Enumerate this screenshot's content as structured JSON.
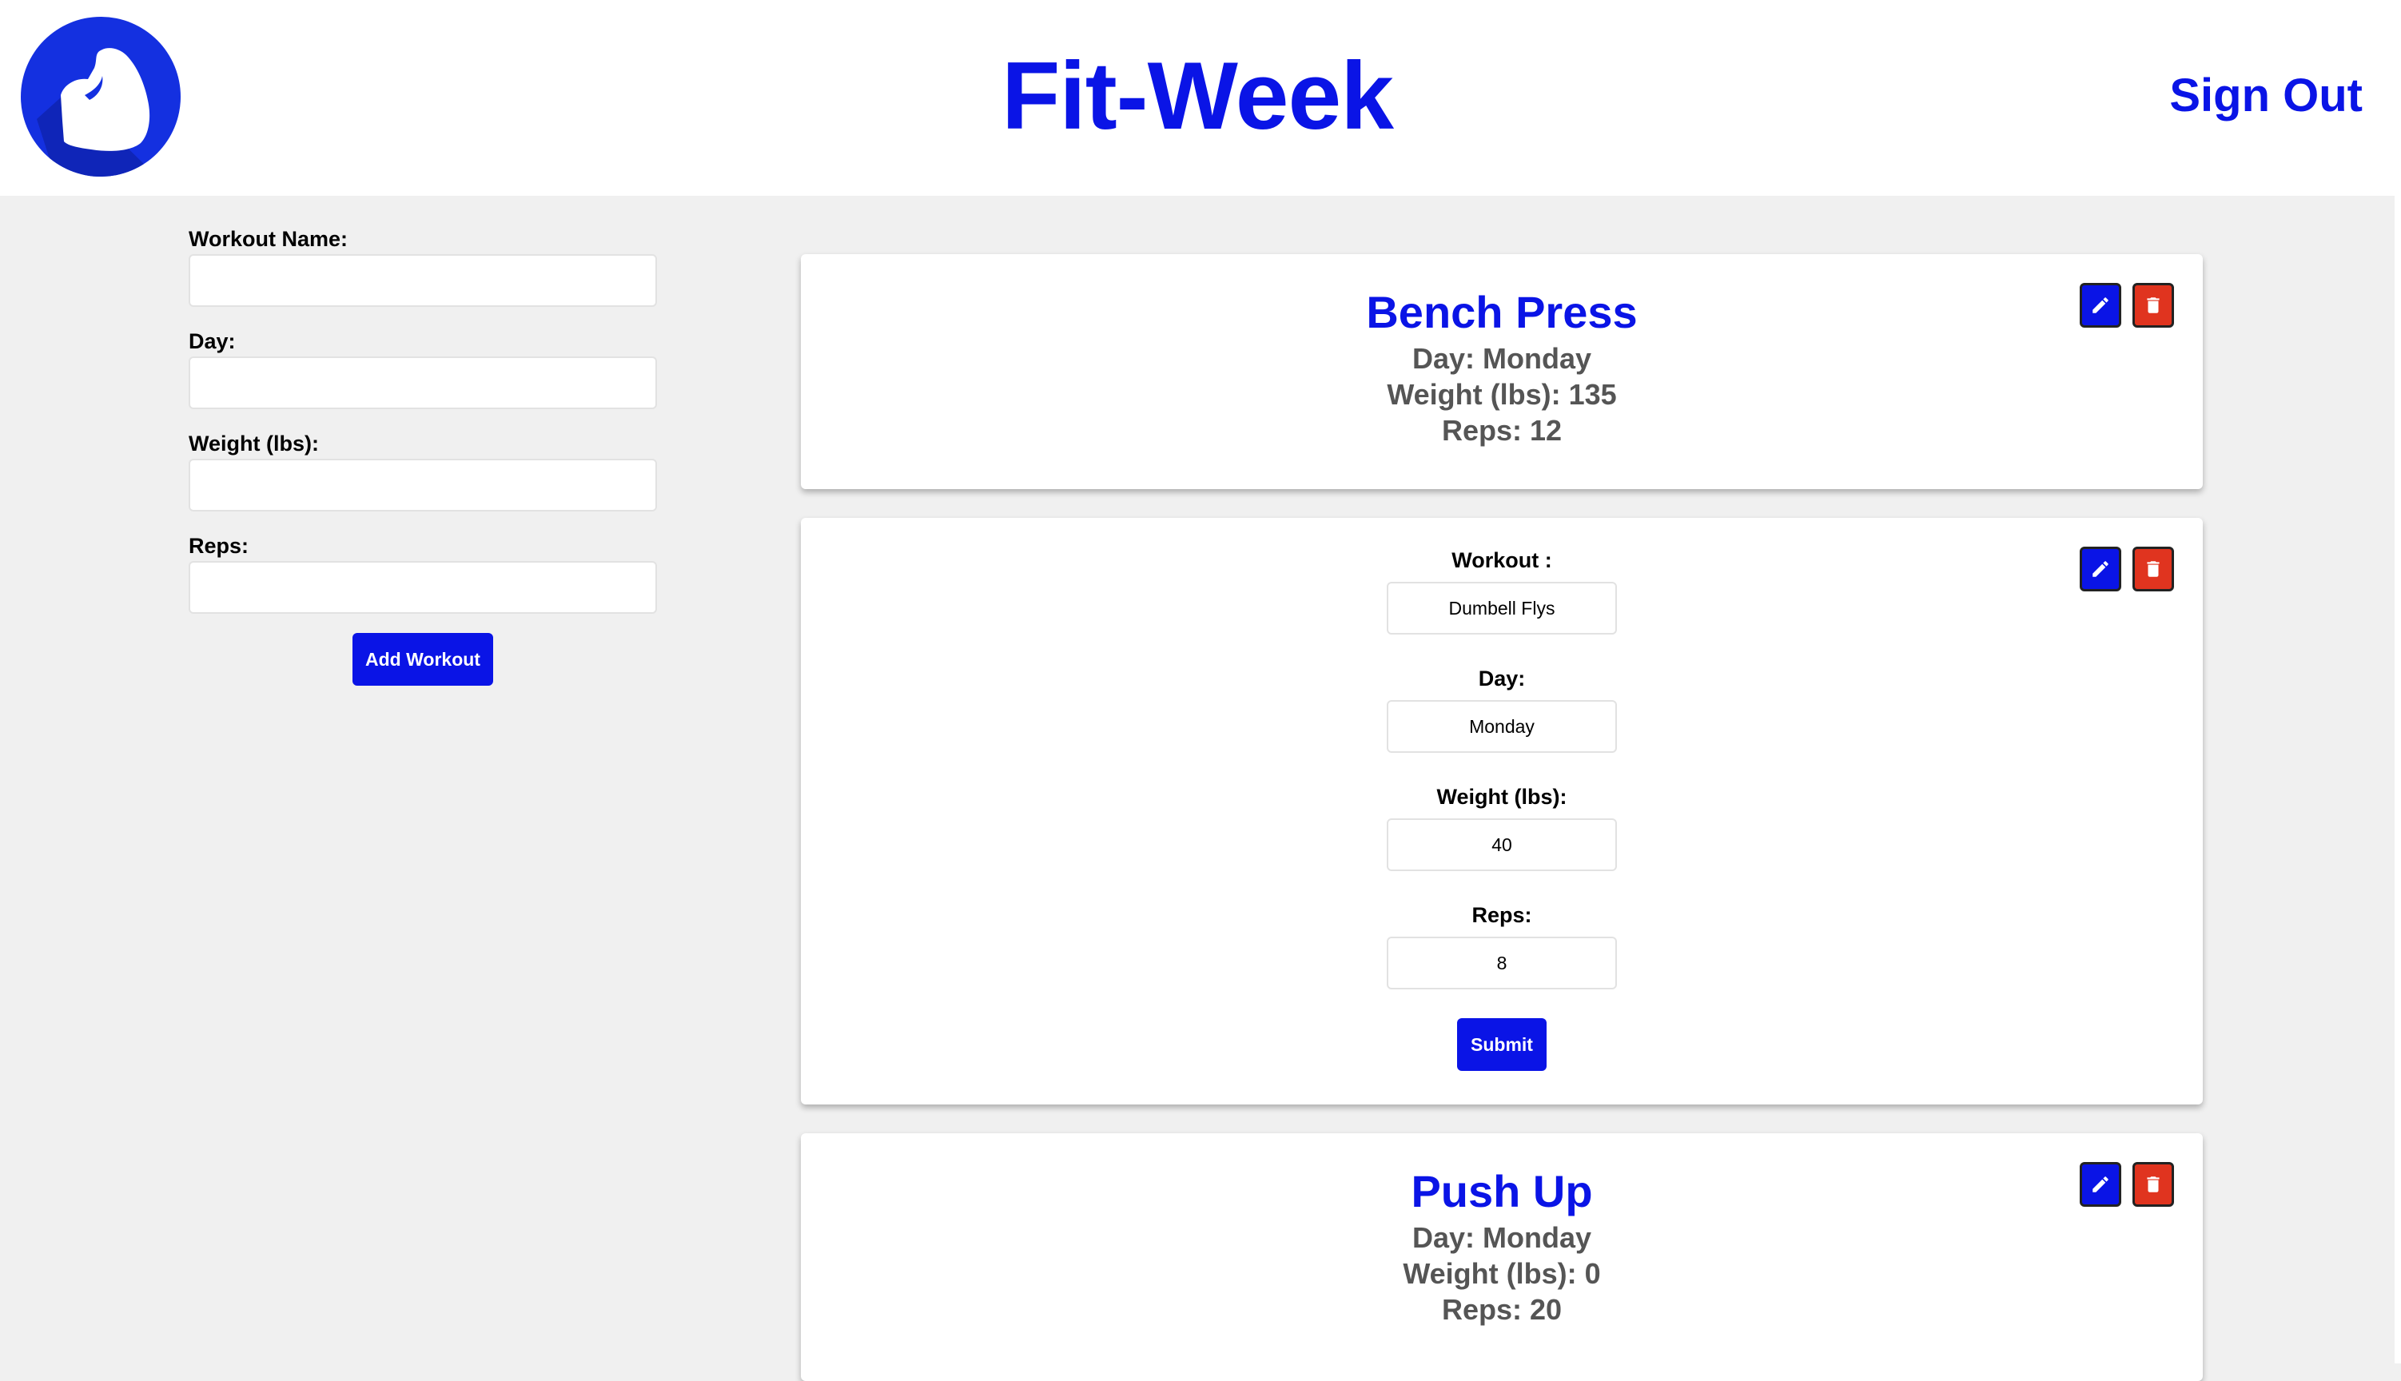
{
  "header": {
    "title": "Fit-Week",
    "sign_out_label": "Sign Out",
    "logo_icon": "flexed-bicep-icon"
  },
  "colors": {
    "brand_blue": "#0a14e6",
    "delete_red": "#e0341f",
    "page_bg": "#f0f0f0"
  },
  "form": {
    "workout_name_label": "Workout Name:",
    "workout_name_value": "",
    "day_label": "Day:",
    "day_value": "",
    "weight_label": "Weight (lbs):",
    "weight_value": "",
    "reps_label": "Reps:",
    "reps_value": "",
    "add_button_label": "Add Workout"
  },
  "workouts": [
    {
      "title": "Bench Press",
      "day": "Day: Monday",
      "weight": "Weight (lbs): 135",
      "reps": "Reps: 12"
    },
    {
      "editing": true,
      "workout_label": "Workout :",
      "workout_value": "Dumbell Flys",
      "day_label": "Day:",
      "day_value": "Monday",
      "weight_label": "Weight (lbs):",
      "weight_value": "40",
      "reps_label": "Reps:",
      "reps_value": "8",
      "submit_label": "Submit"
    },
    {
      "title": "Push Up",
      "day": "Day: Monday",
      "weight": "Weight (lbs): 0",
      "reps": "Reps: 20"
    }
  ],
  "card_actions": {
    "edit_icon": "pencil-icon",
    "delete_icon": "trash-icon"
  }
}
